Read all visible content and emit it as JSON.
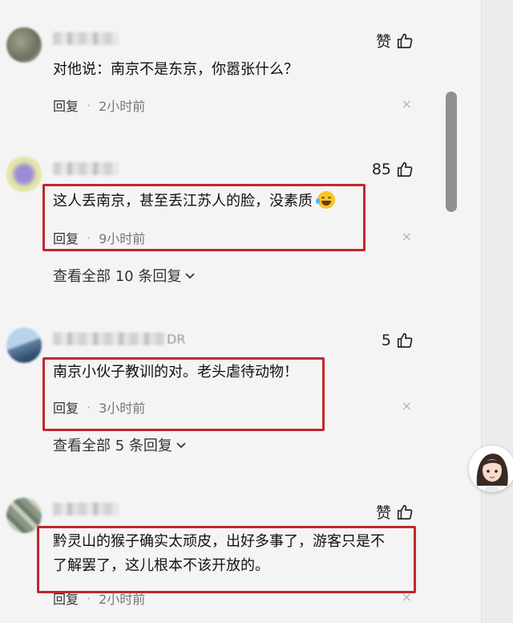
{
  "comments": [
    {
      "name_tail": "",
      "likes": "赞",
      "lines": [
        "对他说：南京不是东京，你嚣张什么？"
      ],
      "reply_label": "回复",
      "time": "2小时前",
      "close": "×"
    },
    {
      "name_tail": "",
      "likes": "85",
      "lines": [
        "这人丢南京，甚至丢江苏人的脸，没素质"
      ],
      "reply_label": "回复",
      "time": "9小时前",
      "close": "×",
      "view_all": "查看全部 10 条回复"
    },
    {
      "name_tail": "DR",
      "likes": "5",
      "lines": [
        "南京小伙子教训的对。老头虐待动物！"
      ],
      "reply_label": "回复",
      "time": "3小时前",
      "close": "×",
      "view_all": "查看全部 5 条回复"
    },
    {
      "name_tail": "",
      "likes": "赞",
      "lines": [
        "黔灵山的猴子确实太顽皮，出好多事了，游客只是不",
        "了解罢了，这儿根本不该开放的。"
      ],
      "reply_label": "回复",
      "time": "2小时前",
      "close": "×"
    }
  ],
  "colors": {
    "highlight": "#c0272d",
    "meta": "#777777"
  }
}
